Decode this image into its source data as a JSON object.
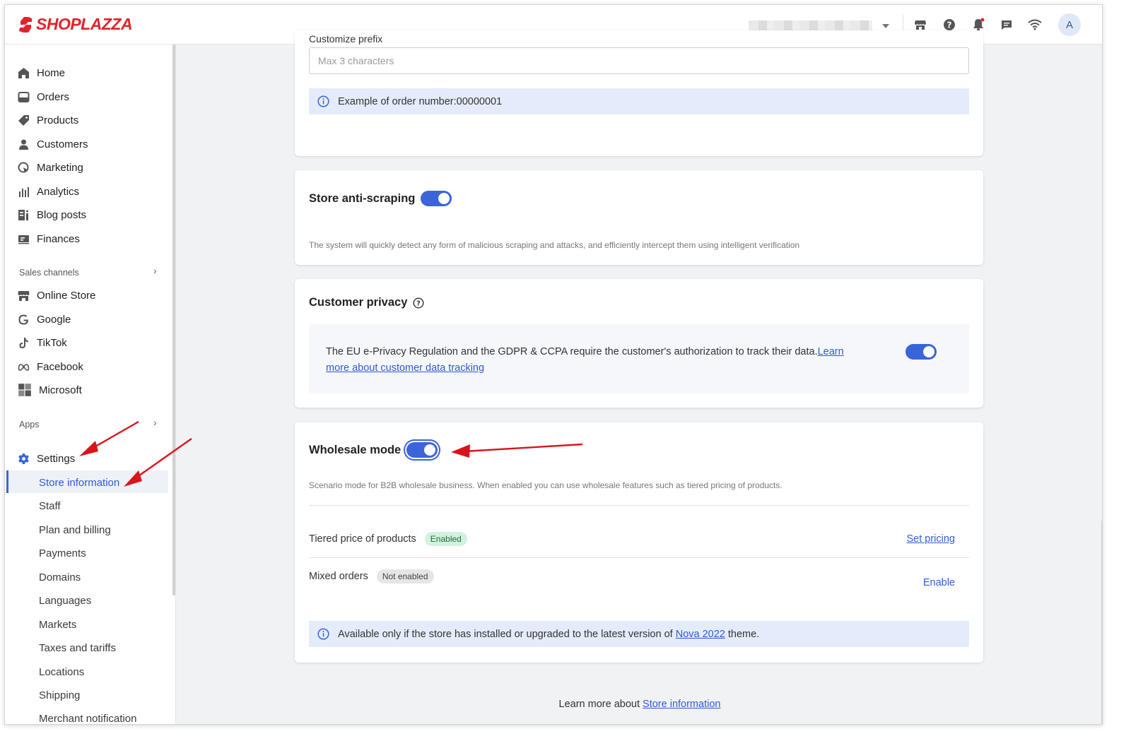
{
  "header": {
    "logo_text": "SHOPLAZZA",
    "avatar_letter": "A",
    "icons": [
      "store-icon",
      "help-icon",
      "notification-bell-icon",
      "message-icon",
      "wifi-icon"
    ]
  },
  "sidebar": {
    "main_items": [
      {
        "label": "Home",
        "icon": "home-icon"
      },
      {
        "label": "Orders",
        "icon": "orders-icon"
      },
      {
        "label": "Products",
        "icon": "tag-icon"
      },
      {
        "label": "Customers",
        "icon": "person-icon"
      },
      {
        "label": "Marketing",
        "icon": "marketing-icon"
      },
      {
        "label": "Analytics",
        "icon": "bar-chart-icon"
      },
      {
        "label": "Blog posts",
        "icon": "blog-icon"
      },
      {
        "label": "Finances",
        "icon": "finance-icon"
      }
    ],
    "sales_channels_label": "Sales channels",
    "channels": [
      {
        "label": "Online Store",
        "icon": "store-icon"
      },
      {
        "label": "Google",
        "icon": "google-icon"
      },
      {
        "label": "TikTok",
        "icon": "tiktok-icon"
      },
      {
        "label": "Facebook",
        "icon": "meta-icon"
      },
      {
        "label": "Microsoft",
        "icon": "microsoft-icon"
      }
    ],
    "apps_label": "Apps",
    "settings_label": "Settings",
    "settings_items": [
      "Store information",
      "Staff",
      "Plan and billing",
      "Payments",
      "Domains",
      "Languages",
      "Markets",
      "Taxes and tariffs",
      "Locations",
      "Shipping",
      "Merchant notification"
    ],
    "active_item": "Store information"
  },
  "order_prefix": {
    "label": "Customize prefix",
    "placeholder": "Max 3 characters",
    "example": "Example of order number:00000001"
  },
  "anti_scraping": {
    "title": "Store anti-scraping",
    "enabled": true,
    "description": "The system will quickly detect any form of malicious scraping and attacks, and efficiently intercept them using intelligent verification"
  },
  "customer_privacy": {
    "title": "Customer privacy",
    "text": "The EU e-Privacy Regulation and the GDPR & CCPA require the customer's authorization to track their data.",
    "link_text": "Learn more about customer data tracking",
    "enabled": true
  },
  "wholesale": {
    "title": "Wholesale mode",
    "enabled": true,
    "description": "Scenario mode for B2B wholesale business. When enabled you can use wholesale features such as tiered pricing of products.",
    "rows": [
      {
        "label": "Tiered price of products",
        "badge": "Enabled",
        "action": "Set pricing"
      },
      {
        "label": "Mixed orders",
        "badge": "Not enabled",
        "action": "Enable"
      }
    ],
    "notice_before": "Available only if the store has installed or upgraded to the latest version of",
    "notice_link": "Nova 2022",
    "notice_after": "theme."
  },
  "footer": {
    "prefix": "Learn more about",
    "link": "Store information"
  },
  "colors": {
    "brand_red": "#e0232b",
    "accent_blue": "#3a64d8",
    "annotation_red": "#d9141b"
  }
}
